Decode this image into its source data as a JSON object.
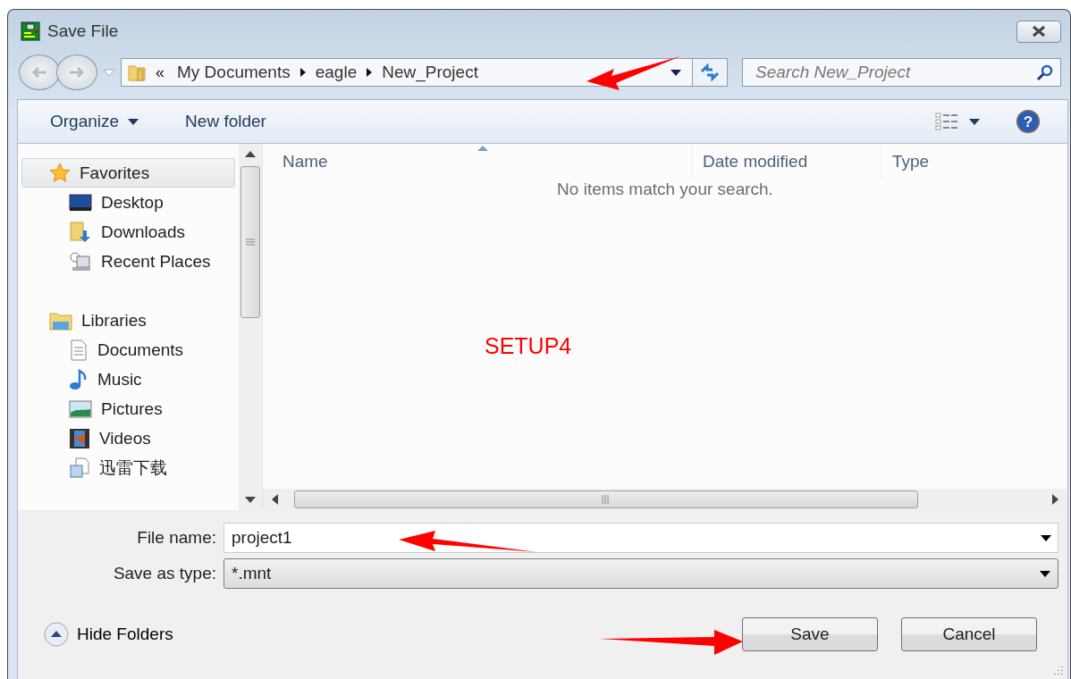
{
  "window": {
    "title": "Save File"
  },
  "address": {
    "overflow": "«",
    "crumbs": [
      "My Documents",
      "eagle",
      "New_Project"
    ]
  },
  "search": {
    "placeholder": "Search New_Project"
  },
  "toolbar": {
    "buttons": [
      {
        "label": "Organize",
        "menu": true
      },
      {
        "label": "New folder",
        "menu": false
      }
    ],
    "help": "?"
  },
  "sidebar": {
    "items": [
      {
        "label": "Favorites",
        "selected": true,
        "children": [
          {
            "label": "Desktop",
            "selected": false
          },
          {
            "label": "Downloads",
            "selected": false
          },
          {
            "label": "Recent Places",
            "selected": false
          }
        ]
      },
      {
        "label": "Libraries",
        "selected": false,
        "children": [
          {
            "label": "Documents",
            "selected": false
          },
          {
            "label": "Music",
            "selected": false
          },
          {
            "label": "Pictures",
            "selected": false
          },
          {
            "label": "Videos",
            "selected": false
          },
          {
            "label": "迅雷下载",
            "selected": false
          }
        ]
      }
    ]
  },
  "table": {
    "columns": [
      {
        "label": "Name",
        "sorted": true
      },
      {
        "label": "Date modified",
        "sorted": false
      },
      {
        "label": "Type",
        "sorted": false
      }
    ],
    "empty_message": "No items match your search."
  },
  "annotation": {
    "text": "SETUP4"
  },
  "form": {
    "file_name_label": "File name:",
    "file_name": "project1",
    "type_label": "Save as type:",
    "type": "*.mnt"
  },
  "footer": {
    "hide_folders": "Hide Folders",
    "buttons": [
      "Save",
      "Cancel"
    ]
  }
}
